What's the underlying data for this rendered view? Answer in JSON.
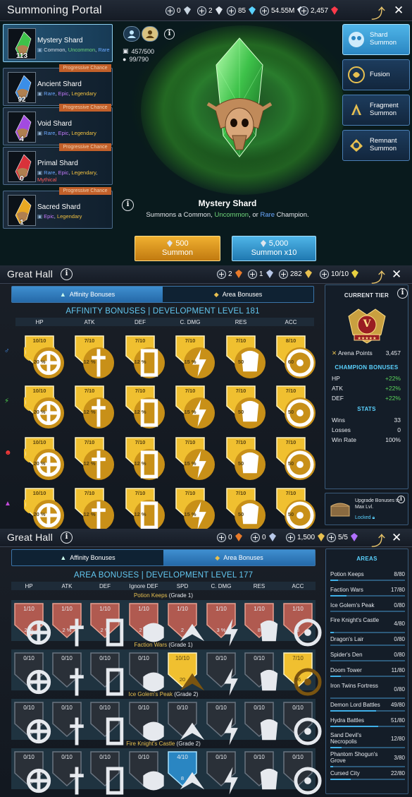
{
  "panel1": {
    "title": "Summoning Portal",
    "currencies": [
      "0",
      "2",
      "85",
      "54.55M",
      "2,457"
    ],
    "shards": [
      {
        "name": "Mystery Shard",
        "count": "113",
        "progressive": "",
        "rarity": [
          {
            "t": "Common",
            "c": ""
          },
          {
            "t": ", ",
            "c": ""
          },
          {
            "t": "Uncommon",
            "c": "c-unc"
          },
          {
            "t": ", ",
            "c": ""
          },
          {
            "t": "Rare",
            "c": "c-rare"
          }
        ],
        "color": "#3ec24a"
      },
      {
        "name": "Ancient Shard",
        "count": "92",
        "progressive": "Progressive Chance",
        "rarity": [
          {
            "t": "Rare",
            "c": "c-rare"
          },
          {
            "t": ", ",
            "c": ""
          },
          {
            "t": "Epic",
            "c": "c-epic"
          },
          {
            "t": ", ",
            "c": ""
          },
          {
            "t": "Legendary",
            "c": "c-leg"
          }
        ],
        "color": "#3a8ee8"
      },
      {
        "name": "Void Shard",
        "count": "4",
        "progressive": "Progressive Chance",
        "rarity": [
          {
            "t": "Rare",
            "c": "c-rare"
          },
          {
            "t": ", ",
            "c": ""
          },
          {
            "t": "Epic",
            "c": "c-epic"
          },
          {
            "t": ", ",
            "c": ""
          },
          {
            "t": "Legendary",
            "c": "c-leg"
          }
        ],
        "color": "#a24ae0"
      },
      {
        "name": "Primal Shard",
        "count": "0",
        "progressive": "Progressive Chance",
        "rarity": [
          {
            "t": "Rare",
            "c": "c-rare"
          },
          {
            "t": ", ",
            "c": ""
          },
          {
            "t": "Epic",
            "c": "c-epic"
          },
          {
            "t": ", ",
            "c": ""
          },
          {
            "t": "Legendary",
            "c": "c-leg"
          },
          {
            "t": ", ",
            "c": ""
          },
          {
            "t": "Mythical",
            "c": "c-myth"
          }
        ],
        "color": "#d8323a"
      },
      {
        "name": "Sacred Shard",
        "count": "1",
        "progressive": "Progressive Chance",
        "rarity": [
          {
            "t": "Epic",
            "c": "c-epic"
          },
          {
            "t": ", ",
            "c": ""
          },
          {
            "t": "Legendary",
            "c": "c-leg"
          }
        ],
        "color": "#e8a822"
      }
    ],
    "stats": [
      "457/500",
      "99/790"
    ],
    "right_buttons": [
      "Shard Summon",
      "Fusion",
      "Fragment Summon",
      "Remnant Summon"
    ],
    "banner_name": "Mystery Shard",
    "banner_desc": [
      {
        "t": "Summons a Common, ",
        "c": ""
      },
      {
        "t": "Uncommon",
        "c": "c-unc"
      },
      {
        "t": ", or ",
        "c": ""
      },
      {
        "t": "Rare",
        "c": "c-rare"
      },
      {
        "t": " Champion.",
        "c": ""
      }
    ],
    "summon1": {
      "cost": "500",
      "label": "Summon"
    },
    "summon10": {
      "cost": "5,000",
      "label": "Summon x10"
    }
  },
  "panel2": {
    "title": "Great Hall",
    "currencies": [
      "2",
      "1",
      "282",
      "10/10"
    ],
    "tabs": [
      "Affinity Bonuses",
      "Area Bonuses"
    ],
    "header": "AFFINITY BONUSES | DEVELOPMENT LEVEL 181",
    "columns": [
      "HP",
      "ATK",
      "DEF",
      "C. DMG",
      "RES",
      "ACC"
    ],
    "affinities": [
      "#4a9cff",
      "#4fd34f",
      "#ff3a3a",
      "#c24ad8"
    ],
    "rows": [
      [
        [
          "10/10",
          "20 %"
        ],
        [
          "7/10",
          "12 %"
        ],
        [
          "7/10",
          "12 %"
        ],
        [
          "7/10",
          "15 %"
        ],
        [
          "7/10",
          "50"
        ],
        [
          "8/10",
          "60"
        ]
      ],
      [
        [
          "10/10",
          "20 %"
        ],
        [
          "7/10",
          "12 %"
        ],
        [
          "7/10",
          "12 %"
        ],
        [
          "7/10",
          "15 %"
        ],
        [
          "7/10",
          "50"
        ],
        [
          "7/10",
          "50"
        ]
      ],
      [
        [
          "10/10",
          "20 %"
        ],
        [
          "7/10",
          "12 %"
        ],
        [
          "7/10",
          "12 %"
        ],
        [
          "7/10",
          "15 %"
        ],
        [
          "7/10",
          "50"
        ],
        [
          "7/10",
          "50"
        ]
      ],
      [
        [
          "10/10",
          "20 %"
        ],
        [
          "7/10",
          "12 %"
        ],
        [
          "7/10",
          "12 %"
        ],
        [
          "7/10",
          "15 %"
        ],
        [
          "7/10",
          "50"
        ],
        [
          "7/10",
          "50"
        ]
      ]
    ],
    "tier": {
      "header": "CURRENT TIER",
      "badge": "V",
      "arena_label": "Arena Points",
      "arena_value": "3,457",
      "bonuses_header": "CHAMPION BONUSES",
      "bonuses": [
        [
          "HP",
          "+22%"
        ],
        [
          "ATK",
          "+22%"
        ],
        [
          "DEF",
          "+22%"
        ]
      ],
      "stats_header": "STATS",
      "stats": [
        [
          "Wins",
          "33"
        ],
        [
          "Losses",
          "0"
        ],
        [
          "Win Rate",
          "100%"
        ]
      ]
    },
    "upgrade": {
      "text": "Upgrade Bonuses to Max Lvl.",
      "locked": "Locked"
    }
  },
  "panel3": {
    "title": "Great Hall",
    "currencies": [
      "0",
      "0",
      "1,500",
      "5/5"
    ],
    "tabs": [
      "Affinity Bonuses",
      "Area Bonuses"
    ],
    "header": "AREA BONUSES | DEVELOPMENT LEVEL 177",
    "columns": [
      "HP",
      "ATK",
      "DEF",
      "Ignore DEF",
      "SPD",
      "C. DMG",
      "RES",
      "ACC"
    ],
    "sections": [
      {
        "name": "Potion Keeps",
        "grade": " (Grade 1)",
        "cells": [
          [
            "1/10",
            "2 %",
            "r"
          ],
          [
            "1/10",
            "2 %",
            "r"
          ],
          [
            "1/10",
            "2 %",
            "r"
          ],
          [
            "1/10",
            "2 %",
            "r"
          ],
          [
            "1/10",
            "2",
            "r"
          ],
          [
            "1/10",
            "3 %",
            "r"
          ],
          [
            "1/10",
            "8",
            "r"
          ],
          [
            "1/10",
            "8",
            "r"
          ]
        ]
      },
      {
        "name": "Faction Wars",
        "grade": " (Grade 1)",
        "cells": [
          [
            "0/10",
            "",
            "d"
          ],
          [
            "0/10",
            "",
            "d"
          ],
          [
            "0/10",
            "",
            "d"
          ],
          [
            "0/10",
            "",
            "d"
          ],
          [
            "10/10",
            "20",
            "g"
          ],
          [
            "0/10",
            "",
            "d"
          ],
          [
            "0/10",
            "",
            "d"
          ],
          [
            "7/10",
            "56",
            "g"
          ]
        ]
      },
      {
        "name": "Ice Golem's Peak",
        "grade": " (Grade 2)",
        "cells": [
          [
            "0/10",
            "",
            "d"
          ],
          [
            "0/10",
            "",
            "d"
          ],
          [
            "0/10",
            "",
            "d"
          ],
          [
            "0/10",
            "",
            "d"
          ],
          [
            "0/10",
            "",
            "d"
          ],
          [
            "0/10",
            "",
            "d"
          ],
          [
            "0/10",
            "",
            "d"
          ],
          [
            "0/10",
            "",
            "d"
          ]
        ]
      },
      {
        "name": "Fire Knight's Castle",
        "grade": " (Grade 2)",
        "cells": [
          [
            "0/10",
            "",
            "d"
          ],
          [
            "0/10",
            "",
            "d"
          ],
          [
            "0/10",
            "",
            "d"
          ],
          [
            "0/10",
            "",
            "d"
          ],
          [
            "4/10",
            "8",
            "b"
          ],
          [
            "0/10",
            "",
            "d"
          ],
          [
            "0/10",
            "",
            "d"
          ],
          [
            "0/10",
            "",
            "d"
          ]
        ]
      }
    ],
    "areas_header": "AREAS",
    "areas": [
      [
        "Potion Keeps",
        "8/80"
      ],
      [
        "Faction Wars",
        "17/80"
      ],
      [
        "Ice Golem's Peak",
        "0/80"
      ],
      [
        "Fire Knight's Castle",
        "4/80"
      ],
      [
        "Dragon's Lair",
        "0/80"
      ],
      [
        "Spider's Den",
        "0/80"
      ],
      [
        "Doom Tower",
        "11/80"
      ],
      [
        "Iron Twins Fortress",
        "0/80"
      ],
      [
        "Demon Lord Battles",
        "49/80"
      ],
      [
        "Hydra Battles",
        "51/80"
      ],
      [
        "Sand Devil's Necropolis",
        "12/80"
      ],
      [
        "Phantom Shogun's Grove",
        "3/80"
      ],
      [
        "Cursed City",
        "22/80"
      ]
    ]
  }
}
